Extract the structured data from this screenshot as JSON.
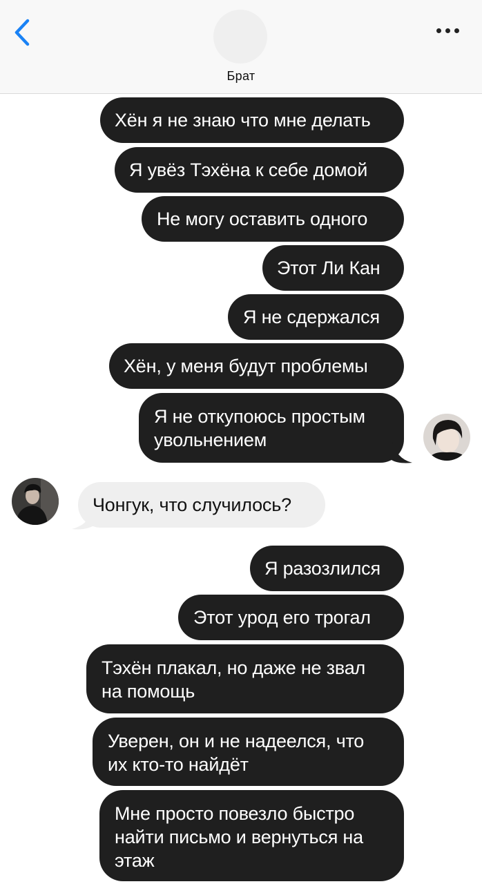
{
  "header": {
    "contact_name": "Брат",
    "back_icon": "chevron-left-icon",
    "more_icon": "more-horizontal-icon",
    "accent_color": "#1a82f5"
  },
  "messages": [
    {
      "dir": "out",
      "text": "Хён я не знаю что мне делать"
    },
    {
      "dir": "out",
      "text": "Я увёз Тэхёна к себе домой"
    },
    {
      "dir": "out",
      "text": "Не могу оставить одного"
    },
    {
      "dir": "out",
      "text": "Этот Ли Кан"
    },
    {
      "dir": "out",
      "text": "Я не сдержался"
    },
    {
      "dir": "out",
      "text": "Хён, у меня будут проблемы"
    },
    {
      "dir": "out",
      "text": "Я не откупоюсь простым\nувольнением"
    },
    {
      "dir": "in",
      "text": "Чонгук, что случилось?"
    },
    {
      "dir": "out",
      "text": "Я разозлился"
    },
    {
      "dir": "out",
      "text": "Этот урод его трогал"
    },
    {
      "dir": "out",
      "text": "Тэхён плакал, но даже не звал\nна помощь"
    },
    {
      "dir": "out",
      "text": "Уверен, он и не надеелся, что\nих кто-то найдёт"
    },
    {
      "dir": "out",
      "text": "Мне просто повезло быстро\nнайти письмо и вернуться на\nэтаж"
    }
  ],
  "colors": {
    "outgoing_bubble": "#1f1f1f",
    "incoming_bubble": "#efefef"
  }
}
